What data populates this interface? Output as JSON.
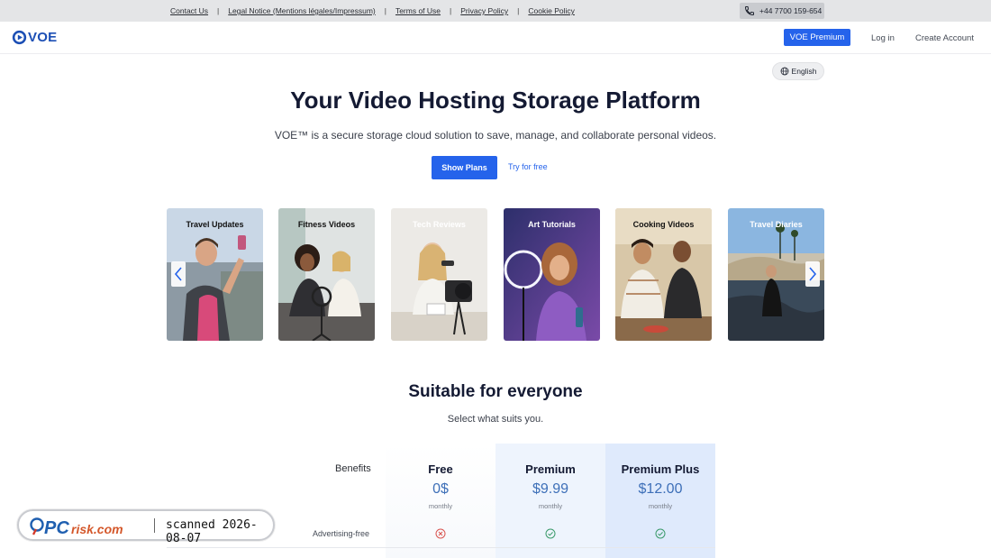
{
  "topbar": {
    "links": [
      "Contact Us",
      "Legal Notice (Mentions légales/Impressum)",
      "Terms of Use",
      "Privacy Policy",
      "Cookie Policy"
    ],
    "separator": "|",
    "phone": "+44 7700 159-654"
  },
  "header": {
    "logo": "VOE",
    "premium_button": "VOE Premium",
    "login": "Log in",
    "create_account": "Create Account"
  },
  "language": "English",
  "hero": {
    "title": "Your Video Hosting Storage Platform",
    "subtitle": "VOE™ is a secure storage cloud solution to save, manage, and collaborate personal videos.",
    "show_plans": "Show Plans",
    "try_free": "Try for free"
  },
  "carousel": {
    "cards": [
      "Travel Updates",
      "Fitness Videos",
      "Tech Reviews",
      "Art Tutorials",
      "Cooking Videos",
      "Travel Diaries"
    ]
  },
  "pricing": {
    "title": "Suitable for everyone",
    "subtitle": "Select what suits you.",
    "benefits_label": "Benefits",
    "plans": [
      {
        "name": "Free",
        "price": "0$",
        "period": "monthly"
      },
      {
        "name": "Premium",
        "price": "$9.99",
        "period": "monthly"
      },
      {
        "name": "Premium Plus",
        "price": "$12.00",
        "period": "monthly"
      }
    ],
    "features": [
      {
        "label": "Advertising-free",
        "values": [
          "no",
          "yes",
          "yes"
        ]
      }
    ]
  },
  "watermark": {
    "brand": "PCrisk.com",
    "scanned": "scanned 2026-08-07"
  },
  "colors": {
    "accent": "#2563eb",
    "price": "#3d6fb8",
    "no_mark": "#d9534f",
    "yes_mark": "#3a9a6a"
  }
}
